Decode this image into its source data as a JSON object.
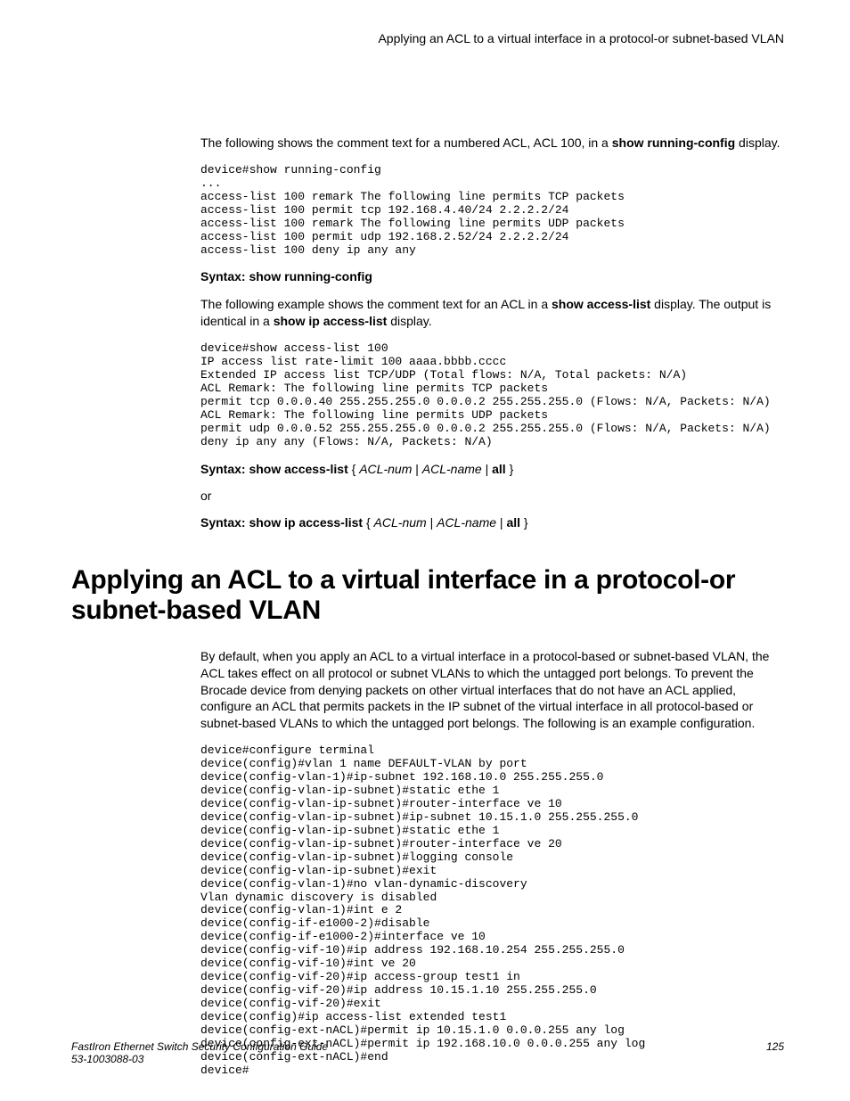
{
  "header": {
    "running_title": "Applying an ACL to a virtual interface in a protocol-or subnet-based VLAN"
  },
  "intro1": {
    "pre": "The following shows the comment text for a numbered ACL, ACL 100, in a ",
    "bold": "show running-config",
    "post": " display."
  },
  "codeblock1": "device#show running-config\n...\naccess-list 100 remark The following line permits TCP packets\naccess-list 100 permit tcp 192.168.4.40/24 2.2.2.2/24\naccess-list 100 remark The following line permits UDP packets\naccess-list 100 permit udp 192.168.2.52/24 2.2.2.2/24\naccess-list 100 deny ip any any",
  "syntax1": {
    "label": "Syntax: show running-config"
  },
  "intro2": {
    "pre": "The following example shows the comment text for an ACL in a ",
    "bold1": "show access-list",
    "mid": " display. The output is identical in a ",
    "bold2": "show ip access-list",
    "post": " display."
  },
  "codeblock2": "device#show access-list 100\nIP access list rate-limit 100 aaaa.bbbb.cccc\nExtended IP access list TCP/UDP (Total flows: N/A, Total packets: N/A)\nACL Remark: The following line permits TCP packets\npermit tcp 0.0.0.40 255.255.255.0 0.0.0.2 255.255.255.0 (Flows: N/A, Packets: N/A)\nACL Remark: The following line permits UDP packets\npermit udp 0.0.0.52 255.255.255.0 0.0.0.2 255.255.255.0 (Flows: N/A, Packets: N/A)\ndeny ip any any (Flows: N/A, Packets: N/A)",
  "syntax2": {
    "prefix": "Syntax: show access-list",
    "arg1": "ACL-num",
    "arg2": "ACL-name",
    "all": "all"
  },
  "or_label": "or",
  "syntax3": {
    "prefix": "Syntax: show ip access-list",
    "arg1": "ACL-num",
    "arg2": "ACL-name",
    "all": "all"
  },
  "section_title": "Applying an ACL to a virtual interface in a protocol-or subnet-based VLAN",
  "section_body": "By default, when you apply an ACL to a virtual interface in a protocol-based or subnet-based VLAN, the ACL takes effect on all protocol or subnet VLANs to which the untagged port belongs. To prevent the Brocade device from denying packets on other virtual interfaces that do not have an ACL applied, configure an ACL that permits packets in the IP subnet of the virtual interface in all protocol-based or subnet-based VLANs to which the untagged port belongs. The following is an example configuration.",
  "codeblock3": "device#configure terminal\ndevice(config)#vlan 1 name DEFAULT-VLAN by port\ndevice(config-vlan-1)#ip-subnet 192.168.10.0 255.255.255.0\ndevice(config-vlan-ip-subnet)#static ethe 1\ndevice(config-vlan-ip-subnet)#router-interface ve 10\ndevice(config-vlan-ip-subnet)#ip-subnet 10.15.1.0 255.255.255.0\ndevice(config-vlan-ip-subnet)#static ethe 1\ndevice(config-vlan-ip-subnet)#router-interface ve 20\ndevice(config-vlan-ip-subnet)#logging console\ndevice(config-vlan-ip-subnet)#exit\ndevice(config-vlan-1)#no vlan-dynamic-discovery\nVlan dynamic discovery is disabled\ndevice(config-vlan-1)#int e 2\ndevice(config-if-e1000-2)#disable\ndevice(config-if-e1000-2)#interface ve 10\ndevice(config-vif-10)#ip address 192.168.10.254 255.255.255.0\ndevice(config-vif-10)#int ve 20\ndevice(config-vif-20)#ip access-group test1 in\ndevice(config-vif-20)#ip address 10.15.1.10 255.255.255.0\ndevice(config-vif-20)#exit\ndevice(config)#ip access-list extended test1\ndevice(config-ext-nACL)#permit ip 10.15.1.0 0.0.0.255 any log\ndevice(config-ext-nACL)#permit ip 192.168.10.0 0.0.0.255 any log\ndevice(config-ext-nACL)#end\ndevice#",
  "footer": {
    "doc_title": "FastIron Ethernet Switch Security Configuration Guide",
    "doc_id": "53-1003088-03",
    "page_num": "125"
  }
}
